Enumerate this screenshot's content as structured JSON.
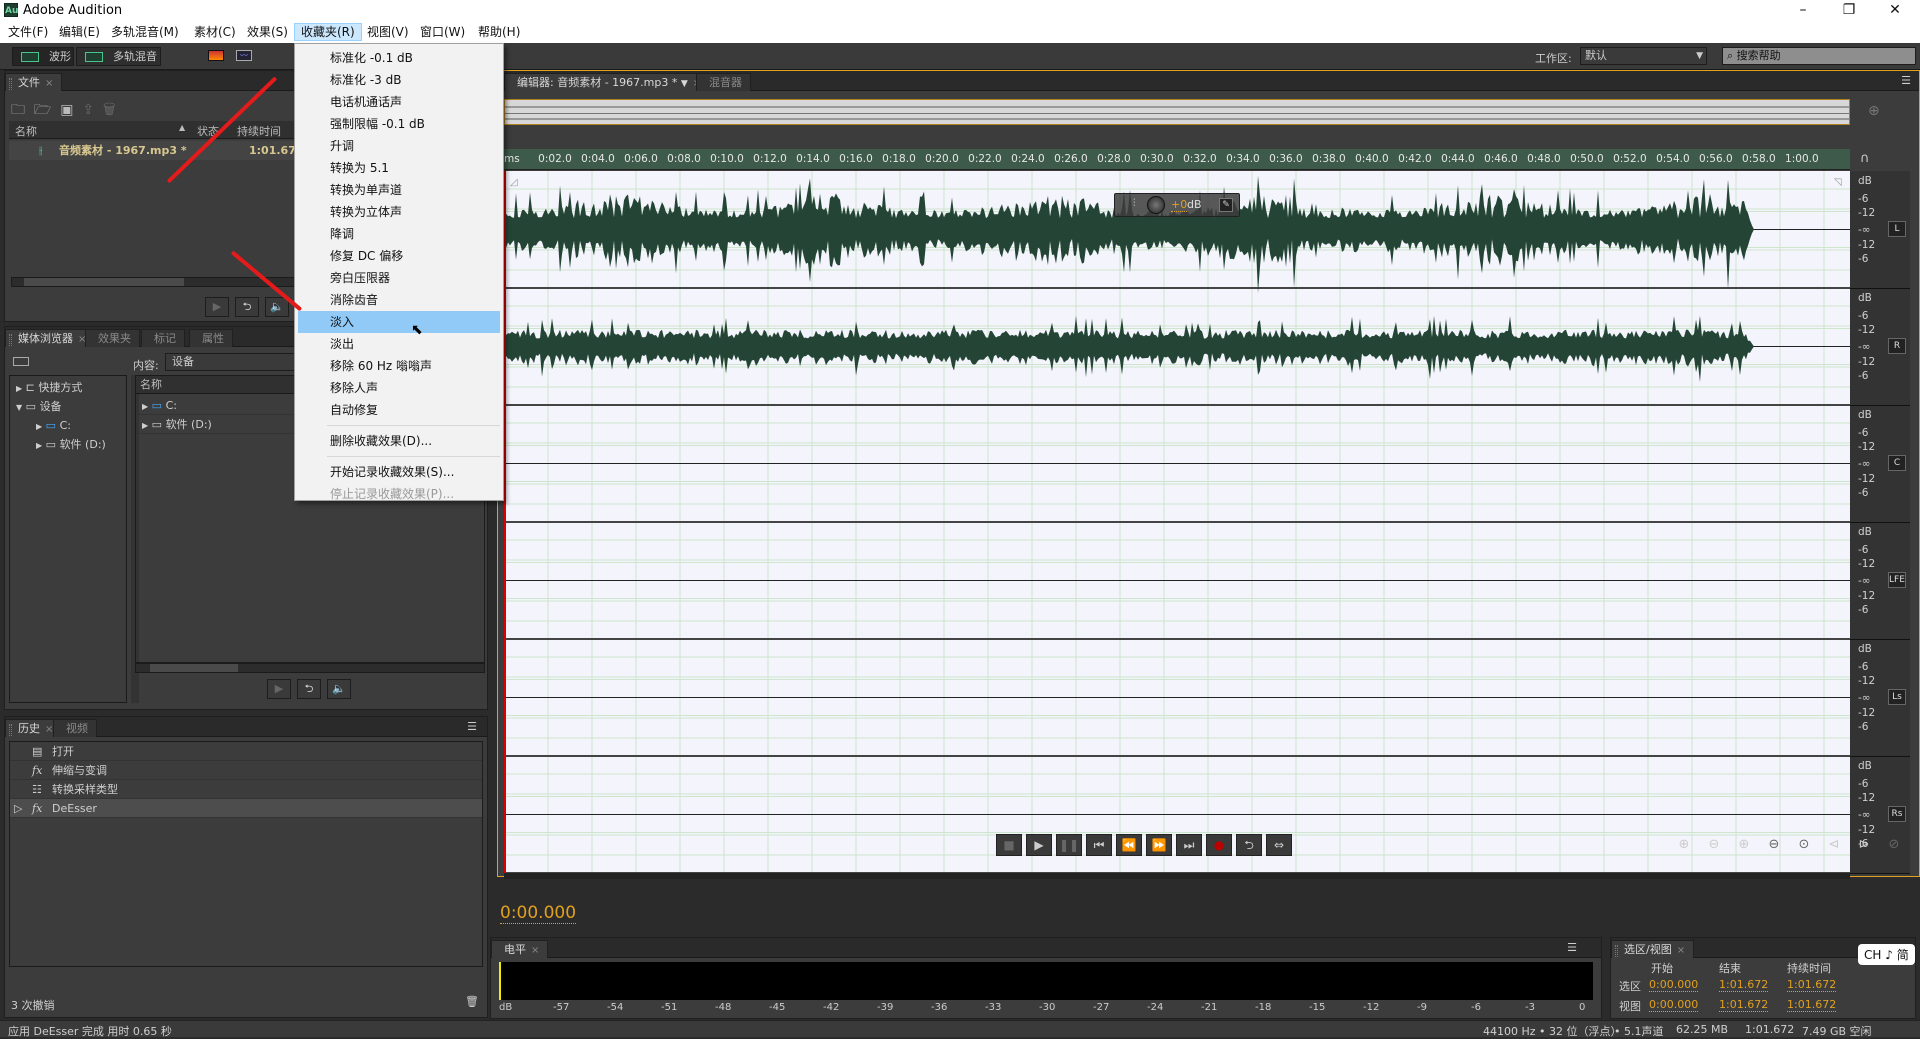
{
  "app": {
    "title": "Adobe Audition",
    "logo": "Au"
  },
  "window_controls": {
    "minimize": "–",
    "maximize": "❐",
    "close": "✕"
  },
  "menubar": [
    {
      "label": "文件(F)"
    },
    {
      "label": "编辑(E)"
    },
    {
      "label": "多轨混音(M)"
    },
    {
      "label": "素材(C)"
    },
    {
      "label": "效果(S)"
    },
    {
      "label": "收藏夹(R)",
      "active": true
    },
    {
      "label": "视图(V)"
    },
    {
      "label": "窗口(W)"
    },
    {
      "label": "帮助(H)"
    }
  ],
  "toolbar": {
    "waveform": "波形",
    "multitrack": "多轨混音",
    "workspace_label": "工作区:",
    "workspace_value": "默认",
    "search_placeholder": "搜索帮助"
  },
  "favorites_menu": {
    "items": [
      {
        "label": "标准化 -0.1 dB"
      },
      {
        "label": "标准化 -3 dB"
      },
      {
        "label": "电话机通话声"
      },
      {
        "label": "强制限幅 -0.1 dB"
      },
      {
        "label": "升调"
      },
      {
        "label": "转换为 5.1"
      },
      {
        "label": "转换为单声道"
      },
      {
        "label": "转换为立体声"
      },
      {
        "label": "降调"
      },
      {
        "label": "修复 DC 偏移"
      },
      {
        "label": "旁白压限器"
      },
      {
        "label": "消除齿音"
      },
      {
        "label": "淡入",
        "highlighted": true
      },
      {
        "label": "淡出"
      },
      {
        "label": "移除 60 Hz 嗡嗡声"
      },
      {
        "label": "移除人声"
      },
      {
        "label": "自动修复"
      }
    ],
    "delete": "删除收藏效果(D)...",
    "start_record": "开始记录收藏效果(S)...",
    "stop_record": "停止记录收藏效果(P)..."
  },
  "files_panel": {
    "tab": "文件",
    "columns": [
      "名称",
      "状态",
      "持续时间"
    ],
    "files": [
      {
        "name": "音频素材 - 1967.mp3 *",
        "duration": "1:01.672"
      }
    ]
  },
  "media_browser": {
    "tabs": [
      "媒体浏览器",
      "效果夹",
      "标记",
      "属性"
    ],
    "content_label": "内容:",
    "content_value": "设备",
    "tree": [
      {
        "label": "快捷方式",
        "level": 0,
        "expanded": false
      },
      {
        "label": "设备",
        "level": 0,
        "expanded": true
      },
      {
        "label": "C:",
        "level": 1
      },
      {
        "label": "软件 (D:)",
        "level": 1
      }
    ],
    "list_header": "名称",
    "list": [
      {
        "label": "C:"
      },
      {
        "label": "软件 (D:)"
      }
    ]
  },
  "history_panel": {
    "tabs": [
      "历史",
      "视频"
    ],
    "items": [
      {
        "label": "打开",
        "icon": "document-icon"
      },
      {
        "label": "伸缩与变调",
        "icon": "fx-icon"
      },
      {
        "label": "转换采样类型",
        "icon": "list-icon"
      },
      {
        "label": "DeEsser",
        "icon": "fx-icon",
        "current": true
      }
    ],
    "undo_count": "3 次撤销"
  },
  "editor": {
    "tab": "编辑器: 音频素材 - 1967.mp3 *",
    "mixer_tab": "混音器",
    "ruler_unit": "ms",
    "ruler_ticks": [
      "0:02.0",
      "0:04.0",
      "0:06.0",
      "0:08.0",
      "0:10.0",
      "0:12.0",
      "0:14.0",
      "0:16.0",
      "0:18.0",
      "0:20.0",
      "0:22.0",
      "0:24.0",
      "0:26.0",
      "0:28.0",
      "0:30.0",
      "0:32.0",
      "0:34.0",
      "0:36.0",
      "0:38.0",
      "0:40.0",
      "0:42.0",
      "0:44.0",
      "0:46.0",
      "0:48.0",
      "0:50.0",
      "0:52.0",
      "0:54.0",
      "0:56.0",
      "0:58.0",
      "1:00.0"
    ],
    "hud_gain": "+0",
    "hud_unit": "dB",
    "channels": [
      "L",
      "R",
      "C",
      "LFE",
      "Ls",
      "Rs"
    ],
    "db_labels": [
      "dB",
      "-6",
      "-12",
      "-∞",
      "-12",
      "-6"
    ],
    "current_time": "0:00.000"
  },
  "levels_panel": {
    "tab": "电平",
    "scale": [
      "dB",
      "-57",
      "-54",
      "-51",
      "-48",
      "-45",
      "-42",
      "-39",
      "-36",
      "-33",
      "-30",
      "-27",
      "-24",
      "-21",
      "-18",
      "-15",
      "-12",
      "-9",
      "-6",
      "-3",
      "0"
    ]
  },
  "selection_panel": {
    "tab": "选区/视图",
    "columns": [
      "开始",
      "结束",
      "持续时间"
    ],
    "rows": [
      {
        "label": "选区",
        "start": "0:00.000",
        "end": "1:01.672",
        "duration": "1:01.672"
      },
      {
        "label": "视图",
        "start": "0:00.000",
        "end": "1:01.672",
        "duration": "1:01.672"
      }
    ]
  },
  "status_bar": {
    "message": "应用 DeEsser 完成 用时 0.65 秒",
    "sample_rate": "44100 Hz • 32 位（浮点）",
    "channels": "• 5.1声道",
    "size": "62.25 MB",
    "duration": "1:01.672",
    "free": "7.49 GB 空闲"
  },
  "ime": {
    "label": "CH ♪ 简"
  },
  "colors": {
    "accent": "#e0a020",
    "waveform": "#244535",
    "menu_highlight": "#91c9f7"
  }
}
